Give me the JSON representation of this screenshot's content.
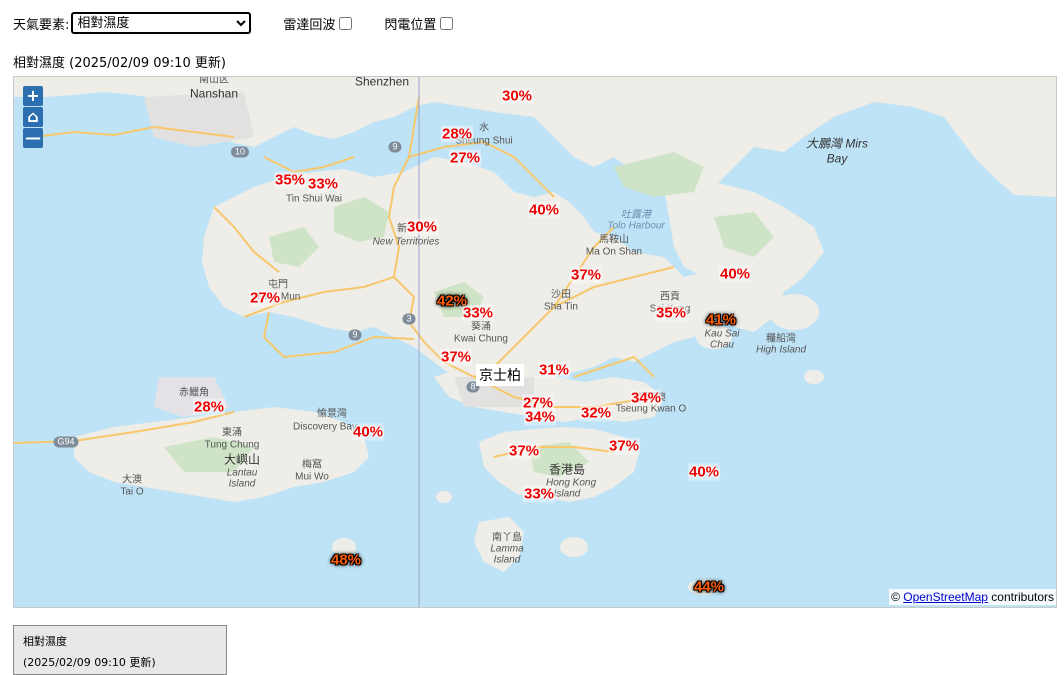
{
  "toolbar": {
    "element_label": "天氣要素:",
    "element_selected": "相對濕度",
    "radar_label": "雷達回波",
    "lightning_label": "閃電位置"
  },
  "map_title": "相對濕度 (2025/02/09 09:10 更新)",
  "map": {
    "zoom_in": "+",
    "home": "⌂",
    "zoom_out": "—",
    "attribution_prefix": "© ",
    "attribution_link": "OpenStreetMap",
    "attribution_suffix": " contributors",
    "station_label": "京士柏",
    "readings": [
      "30%",
      "28%",
      "27%",
      "35%",
      "33%",
      "30%",
      "40%",
      "37%",
      "40%",
      "27%",
      "42%",
      "33%",
      "35%",
      "41%",
      "37%",
      "31%",
      "28%",
      "27%",
      "34%",
      "32%",
      "34%",
      "40%",
      "37%",
      "37%",
      "40%",
      "33%",
      "48%",
      "44%"
    ],
    "places": [
      "南山区",
      "Nanshan",
      "Shenzhen",
      "水",
      "Sheung Shui",
      "Tin Shui Wai",
      "新",
      "New Territories",
      "大鵬灣 Mirs",
      "Bay",
      "吐露港",
      "Tolo Harbour",
      "馬鞍山",
      "Ma On Shan",
      "沙田",
      "Sha Tin",
      "西貢",
      "Sai Kung",
      "葵涌",
      "Kwai Chung",
      "屯門",
      "Tuen Mun",
      "糧船灣",
      "High Island",
      "赤鱲角",
      "愉景灣",
      "Discovery Bay",
      "東涌",
      "Tung Chung",
      "大嶼山",
      "Lantau",
      "Island",
      "梅窩",
      "Mui Wo",
      "大澳",
      "Tai O",
      "將軍澳",
      "Tseung Kwan O",
      "香港島",
      "Hong Kong",
      "Island",
      "南丫島",
      "Lamma",
      "Island",
      "Kau Sai",
      "Chau",
      "10",
      "9",
      "3",
      "9",
      "8",
      "G94"
    ]
  },
  "legend": {
    "title": "相對濕度",
    "time": "(2025/02/09 09:10 更新)"
  },
  "colors": {
    "reading_normal": "#e00000",
    "reading_hot": "#ff5a00",
    "water": "#bfe3f6",
    "land": "#efede8",
    "road": "#f7c76b"
  }
}
